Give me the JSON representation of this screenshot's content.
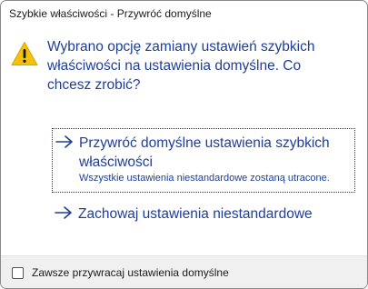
{
  "window": {
    "title": "Szybkie właściwości - Przywróć domyślne"
  },
  "dialog": {
    "icon": "warning-icon",
    "main_instruction": "Wybrano opcję zamiany ustawień szybkich właściwości na ustawienia domyślne. Co chcesz zrobić?",
    "options": [
      {
        "icon": "arrow-right-icon",
        "label": "Przywróć domyślne ustawienia szybkich właściwości",
        "note": "Wszystkie ustawienia niestandardowe zostaną utracone.",
        "focused": true
      },
      {
        "icon": "arrow-right-icon",
        "label": "Zachowaj ustawienia niestandardowe"
      }
    ]
  },
  "footer": {
    "checkbox_label": "Zawsze przywracaj ustawienia domyślne",
    "checkbox_checked": false
  },
  "colors": {
    "accent": "#1e3e99",
    "warning": "#f4c20d",
    "footer_bg": "#f0f0f0"
  }
}
